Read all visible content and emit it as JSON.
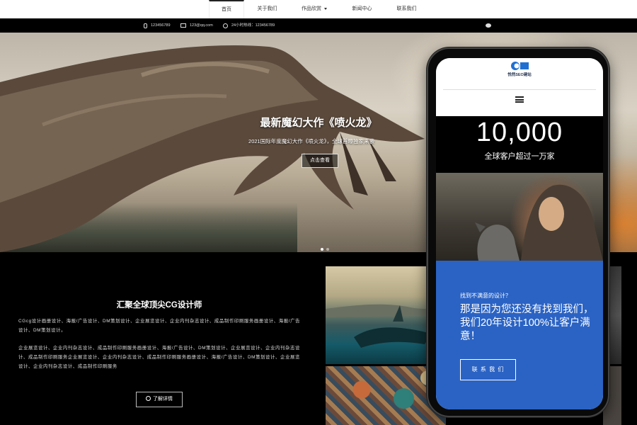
{
  "nav": {
    "items": [
      {
        "label": "首页",
        "active": true
      },
      {
        "label": "关于我们"
      },
      {
        "label": "作品欣赏",
        "dropdown": true
      },
      {
        "label": "新闻中心"
      },
      {
        "label": "联系我们"
      }
    ]
  },
  "contact": {
    "phone": "123456789",
    "email": "123@qq.com",
    "hotline": "24小时热线：123456789"
  },
  "hero": {
    "title": "最新魔幻大作《喷火龙》",
    "subtitle": "2021国际年度魔幻大作《喷火龙》，全球首曝独家来袭",
    "button": "点击查看"
  },
  "section": {
    "title": "汇聚全球顶尖CG设计师",
    "para1": "CGcg设计画册设计、海报/广告设计、DM策划设计、企业展览设计、企业内刊杂志设计、成品制作印刷服务画册设计、海报/广告设计、DM策划设计。",
    "para2": "企业展览设计、企业内刊杂志设计、成品制作印刷服务画册设计、海报/广告设计、DM策划设计、企业展览设计、企业内刊杂志设计、成品制作印刷服务企业展览设计、企业内刊杂志设计、成品制作印刷服务画册设计、海报/广告设计、DM策划设计、企业展览设计、企业内刊杂志设计、成品制作印刷服务",
    "button": "了解详情"
  },
  "phone": {
    "brand": "悦然SEO建站",
    "stat_number": "10,000",
    "stat_caption": "全球客户超过一万家",
    "question": "找到不满意的设计？",
    "headline": "那是因为您还没有找到我们，我们20年设计100%让客户满意！",
    "cta": "联 系 我 们"
  },
  "colors": {
    "accent_blue": "#2b63c4",
    "nav_bg": "#ffffff",
    "bar_bg": "#000000"
  }
}
